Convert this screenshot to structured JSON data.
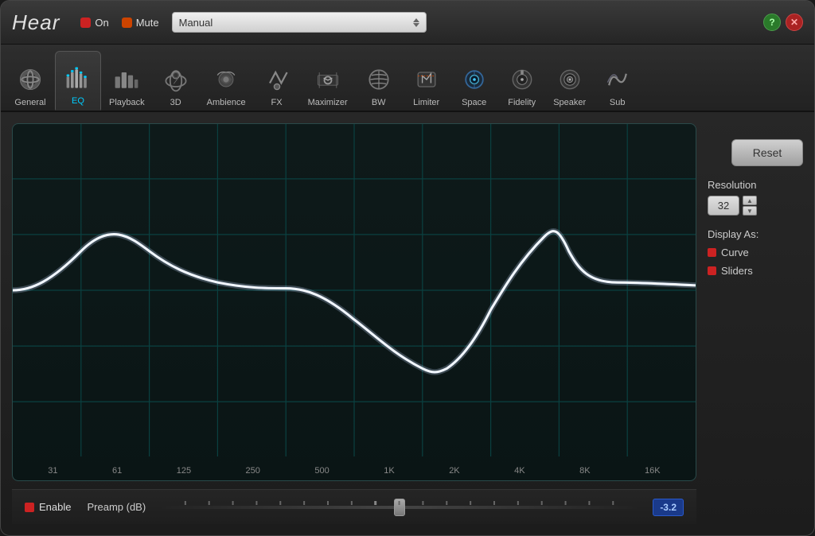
{
  "app": {
    "title": "Hear",
    "on_label": "On",
    "mute_label": "Mute",
    "preset_value": "Manual",
    "help_icon": "?",
    "close_icon": "✕"
  },
  "tabs": [
    {
      "id": "general",
      "label": "General",
      "active": false
    },
    {
      "id": "eq",
      "label": "EQ",
      "active": true
    },
    {
      "id": "playback",
      "label": "Playback",
      "active": false
    },
    {
      "id": "3d",
      "label": "3D",
      "active": false
    },
    {
      "id": "ambience",
      "label": "Ambience",
      "active": false
    },
    {
      "id": "fx",
      "label": "FX",
      "active": false
    },
    {
      "id": "maximizer",
      "label": "Maximizer",
      "active": false
    },
    {
      "id": "bw",
      "label": "BW",
      "active": false
    },
    {
      "id": "limiter",
      "label": "Limiter",
      "active": false
    },
    {
      "id": "space",
      "label": "Space",
      "active": false
    },
    {
      "id": "fidelity",
      "label": "Fidelity",
      "active": false
    },
    {
      "id": "speaker",
      "label": "Speaker",
      "active": false
    },
    {
      "id": "sub",
      "label": "Sub",
      "active": false
    }
  ],
  "eq": {
    "freq_labels": [
      "31",
      "61",
      "125",
      "250",
      "500",
      "1K",
      "2K",
      "4K",
      "8K",
      "16K"
    ],
    "reset_label": "Reset",
    "resolution_label": "Resolution",
    "resolution_value": "32",
    "display_label": "Display As:",
    "display_curve": "Curve",
    "display_sliders": "Sliders",
    "enable_label": "Enable",
    "preamp_label": "Preamp (dB)",
    "preamp_value": "-3.2"
  }
}
